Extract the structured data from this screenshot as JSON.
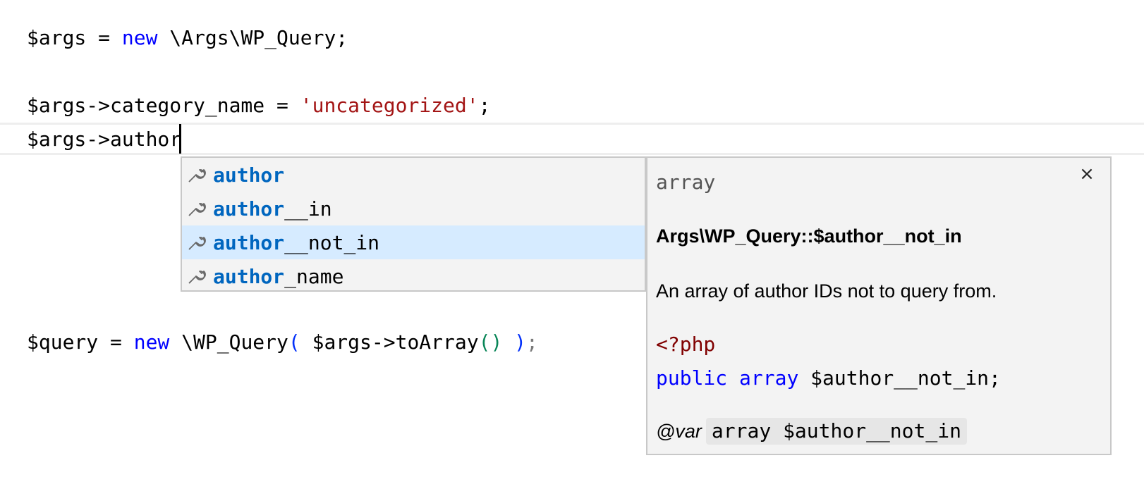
{
  "editor": {
    "line1": {
      "var": "$args = ",
      "kw": "new",
      "rest": " \\Args\\WP_Query;"
    },
    "line2": {
      "prefix": "$args->category_name = ",
      "string": "'uncategorized'",
      "suffix": ";"
    },
    "line3": {
      "text": "$args->author"
    },
    "line4": {
      "var": "$query = ",
      "kw": "new",
      "cls": " \\WP_Query",
      "open_paren": "(",
      "mid": " $args->toArray",
      "inner_parens": "()",
      "close_paren": " )",
      "semi": ";"
    }
  },
  "suggest": {
    "items": [
      {
        "match": "author",
        "rest": "",
        "icon": "wrench-icon",
        "selected": false
      },
      {
        "match": "author",
        "rest": "__in",
        "icon": "wrench-icon",
        "selected": false
      },
      {
        "match": "author",
        "rest": "__not_in",
        "icon": "wrench-icon",
        "selected": true
      },
      {
        "match": "author",
        "rest": "_name",
        "icon": "wrench-icon",
        "selected": false
      }
    ]
  },
  "details": {
    "close_icon": "×",
    "type": "array",
    "title": "Args\\WP_Query::$author__not_in",
    "description": "An array of author IDs not to query from.",
    "code_open_tag": "<?php",
    "code_kw_public": "public",
    "code_kw_array": "array",
    "code_var": " $author__not_in;",
    "var_tag": "@var",
    "var_code": "array $author__not_in"
  },
  "colors": {
    "keyword": "#0000ff",
    "string": "#a31515",
    "match": "#0066bf",
    "selected_bg": "#d6ebff",
    "widget_bg": "#f3f3f3"
  }
}
